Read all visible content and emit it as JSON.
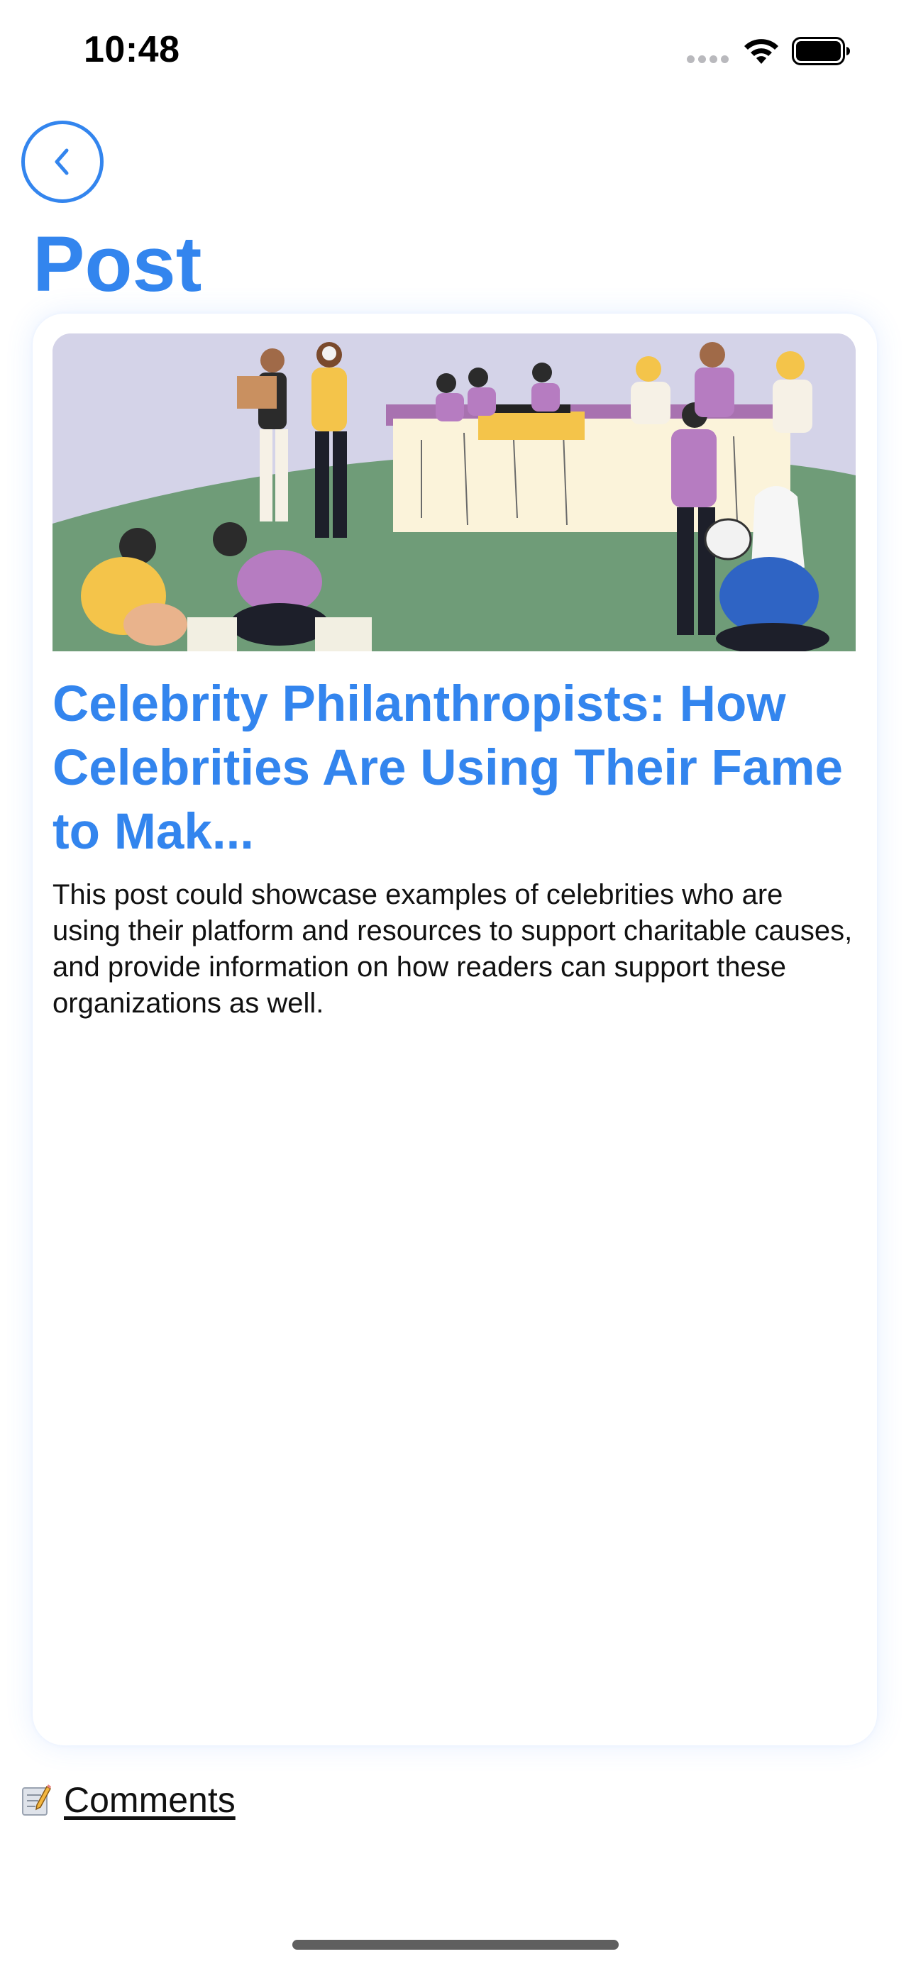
{
  "status_bar": {
    "time": "10:48"
  },
  "header": {
    "back_icon": "chevron-left-icon",
    "title": "Post"
  },
  "post": {
    "image_alt": "Illustration of volunteers sorting donations at a charity event",
    "title": "Celebrity Philanthropists: How Celebrities Are Using Their Fame to Mak...",
    "body": "This post could showcase examples of celebrities who are using their platform and resources to support charitable causes, and provide information on how readers can support these organizations as well."
  },
  "footer": {
    "comments_icon": "memo-icon",
    "comments_label": "Comments"
  },
  "colors": {
    "accent": "#3385ee",
    "text": "#111111",
    "image_sky": "#d4d3e8",
    "image_grass": "#6f9c78"
  }
}
